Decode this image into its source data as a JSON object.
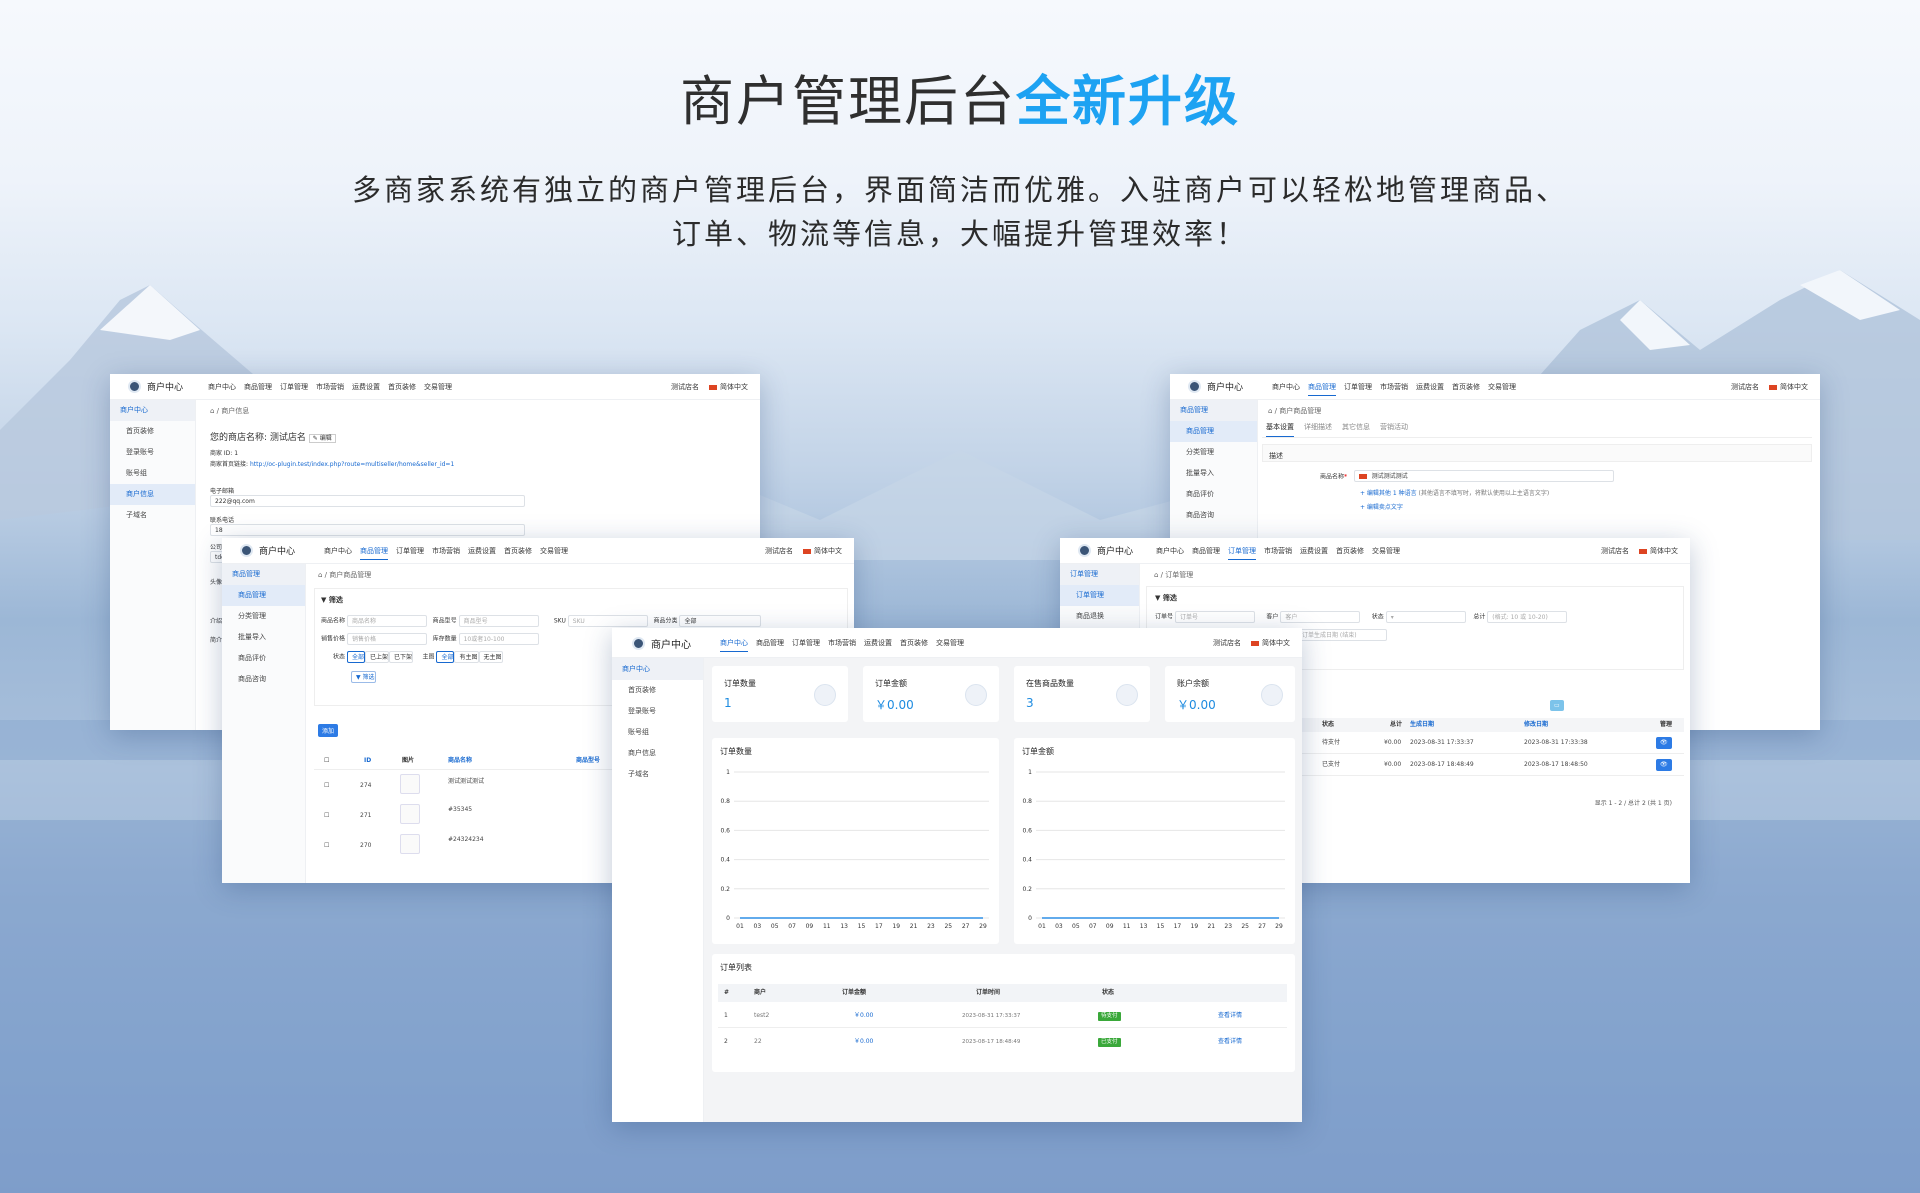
{
  "hero": {
    "title_main": "商户管理后台",
    "title_highlight": "全新升级",
    "intro_line1": "多商家系统有独立的商户管理后台，界面简洁而优雅。入驻商户可以轻松地管理商品、",
    "intro_line2": "订单、物流等信息，大幅提升管理效率！"
  },
  "common": {
    "brand": "商户中心",
    "store_menu": "测试店名",
    "language": "简体中文",
    "nav": [
      "商户中心",
      "商品管理",
      "订单管理",
      "市场营销",
      "运费设置",
      "首页装修",
      "交易管理"
    ]
  },
  "win_info": {
    "sidebar": [
      "商户中心",
      "首页装修",
      "登录账号",
      "账号组",
      "商户信息",
      "子域名"
    ],
    "crumb": "商户信息",
    "store_name": "您的商店名称: 测试店名",
    "edit": "编辑",
    "merchant_id": "商家 ID: 1",
    "home_link_label": "商家首页链接:",
    "home_link": "http://oc-plugin.test/index.php?route=multiseller/home&seller_id=1",
    "email_label": "电子邮箱",
    "email_value": "222@qq.com",
    "phone_label": "联系电话",
    "phone_value": "18",
    "company_label": "公司",
    "company_value": "tdc",
    "avatar_label": "头像",
    "intro_label": "简介",
    "extra_label": "介绍"
  },
  "win_products": {
    "sidebar": [
      "商品管理",
      "商品管理",
      "分类管理",
      "批量导入",
      "商品评价",
      "商品咨询"
    ],
    "crumb": "商户商品管理",
    "filter": "筛选",
    "f_name": "商品名称",
    "f_name_ph": "商品名称",
    "f_model": "商品型号",
    "f_model_ph": "商品型号",
    "f_sku": "SKU",
    "f_sku_ph": "SKU",
    "f_cat": "商品分类",
    "f_cat_val": "全部",
    "f_price": "销售价格",
    "f_price_ph": "销售价格",
    "f_stock": "库存数量",
    "f_stock_ph": "10或者10-100",
    "status_label": "状态",
    "status_opts": [
      "全部",
      "已上架",
      "已下架"
    ],
    "main_label": "主图",
    "main_opts": [
      "全部",
      "有主图",
      "无主图"
    ],
    "filter_btn": "筛选",
    "add_btn": "添加",
    "col_id": "ID",
    "col_img": "图片",
    "col_name": "商品名称",
    "col_model": "商品型号",
    "rows": [
      {
        "id": "274",
        "name": "测试测试测试"
      },
      {
        "id": "271",
        "name": "#35345"
      },
      {
        "id": "270",
        "name": "#24324234"
      }
    ]
  },
  "win_edit": {
    "sidebar": [
      "商品管理",
      "商品管理",
      "分类管理",
      "批量导入",
      "商品评价",
      "商品咨询"
    ],
    "crumb": "商户商品管理",
    "tabs": [
      "基本设置",
      "详细描述",
      "其它信息",
      "营销活动"
    ],
    "section": "描述",
    "name_label": "商品名称",
    "name_value": "测试测试测试",
    "lang_link": "+ 编辑其他 1 种语言",
    "lang_hint": "(其他语言不填写时，将默认使用以上主语言文字)",
    "selling_link": "+ 编辑卖点文字"
  },
  "win_orders": {
    "sidebar": [
      "订单管理",
      "订单管理",
      "商品退换"
    ],
    "crumb": "订单管理",
    "filter": "筛选",
    "f_no": "订单号",
    "f_no_ph": "订单号",
    "f_cust": "客户",
    "f_cust_ph": "客户",
    "f_status": "状态",
    "f_total": "总计",
    "f_total_ph": "(格式: 10 或 10-20)",
    "f_date_ph": "订单生成日期 (结束)",
    "cols": [
      "状态",
      "总计",
      "生成日期",
      "修改日期",
      "管理"
    ],
    "rows": [
      {
        "status": "待支付",
        "total": "¥0.00",
        "created": "2023-08-31 17:33:37",
        "modified": "2023-08-31 17:33:38"
      },
      {
        "status": "已支付",
        "total": "¥0.00",
        "created": "2023-08-17 18:48:49",
        "modified": "2023-08-17 18:48:50"
      }
    ],
    "pager": "显示 1 - 2 / 总计 2 (共 1 页)"
  },
  "win_dash": {
    "sidebar": [
      "商户中心",
      "首页装修",
      "登录账号",
      "账号组",
      "商户信息",
      "子域名"
    ],
    "stats": [
      {
        "label": "订单数量",
        "value": "1",
        "icon": "document-icon"
      },
      {
        "label": "订单金额",
        "value": "￥0.00",
        "icon": "wallet-icon"
      },
      {
        "label": "在售商品数量",
        "value": "3",
        "icon": "box-icon"
      },
      {
        "label": "账户余额",
        "value": "￥0.00",
        "icon": "wallet-icon"
      }
    ],
    "list_title": "订单列表",
    "list_cols": [
      "#",
      "商户",
      "订单金额",
      "订单时间",
      "状态"
    ],
    "list_rows": [
      {
        "n": "1",
        "merchant": "test2",
        "amount": "￥0.00",
        "time": "2023-08-31 17:33:37",
        "status": "待支付",
        "status_color": "#3aa83a",
        "action": "查看详情"
      },
      {
        "n": "2",
        "merchant": "22",
        "amount": "￥0.00",
        "time": "2023-08-17 18:48:49",
        "status": "已支付",
        "status_color": "#3aa83a",
        "action": "查看详情"
      }
    ]
  },
  "chart_data": [
    {
      "type": "line",
      "title": "订单数量",
      "x": [
        "01",
        "03",
        "05",
        "07",
        "09",
        "11",
        "13",
        "15",
        "17",
        "19",
        "21",
        "23",
        "25",
        "27",
        "29"
      ],
      "y_ticks": [
        "0",
        "0.2",
        "0.4",
        "0.6",
        "0.8",
        "1"
      ],
      "ylim": [
        0,
        1
      ],
      "series": [
        {
          "values": [
            0,
            0,
            0,
            0,
            0,
            0,
            0,
            0,
            0,
            0,
            0,
            0,
            0,
            0,
            0
          ]
        }
      ]
    },
    {
      "type": "line",
      "title": "订单金额",
      "x": [
        "01",
        "03",
        "05",
        "07",
        "09",
        "11",
        "13",
        "15",
        "17",
        "19",
        "21",
        "23",
        "25",
        "27",
        "29"
      ],
      "y_ticks": [
        "0",
        "0.2",
        "0.4",
        "0.6",
        "0.8",
        "1"
      ],
      "ylim": [
        0,
        1
      ],
      "series": [
        {
          "values": [
            0,
            0,
            0,
            0,
            0,
            0,
            0,
            0,
            0,
            0,
            0,
            0,
            0,
            0,
            0
          ]
        }
      ]
    }
  ],
  "colors": {
    "accent": "#1da2f2",
    "primary": "#1769d0"
  }
}
